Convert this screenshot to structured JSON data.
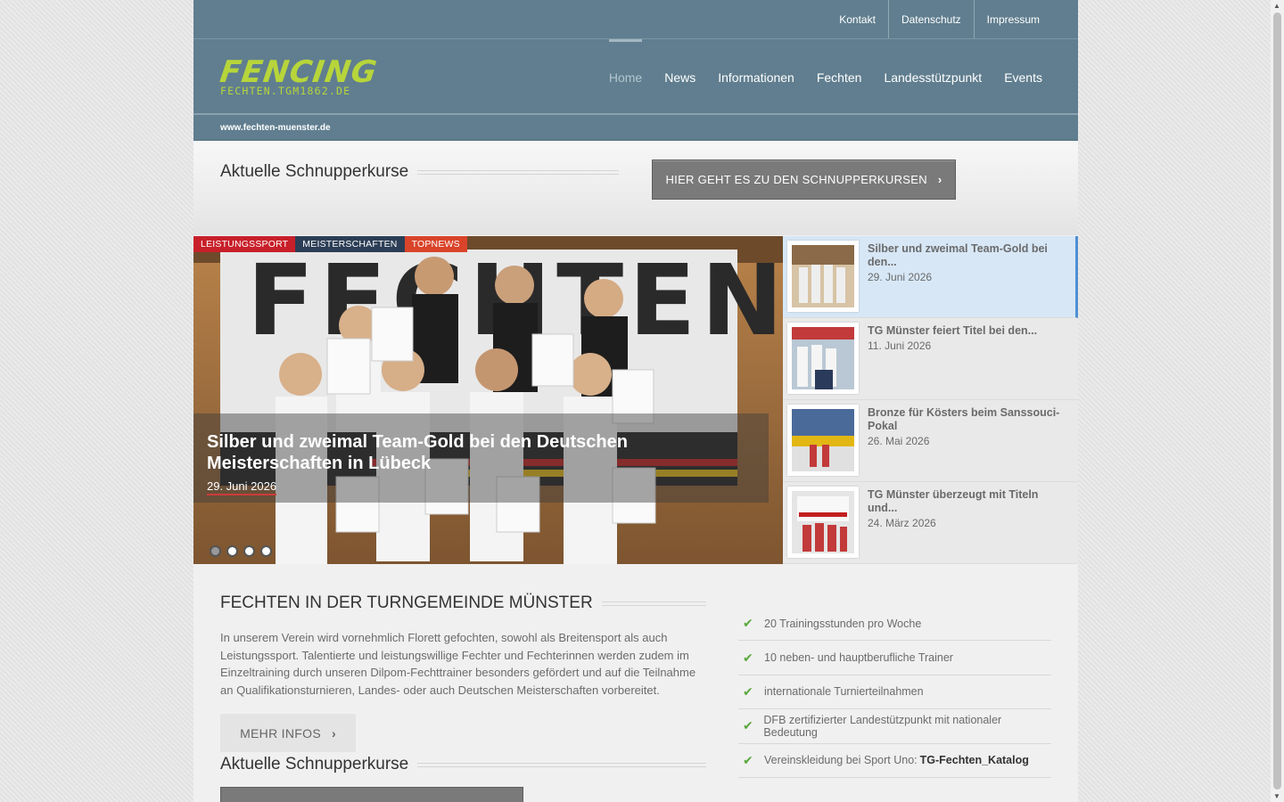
{
  "topbar": {
    "links": [
      "Kontakt",
      "Datenschutz",
      "Impressum"
    ]
  },
  "logo": {
    "main": "FENCING",
    "sub": "FECHTEN.TGM1862.DE"
  },
  "nav": {
    "items": [
      "Home",
      "News",
      "Informationen",
      "Fechten",
      "Landesstützpunkt",
      "Events"
    ]
  },
  "subbar": {
    "text": "www.fechten-muenster.de"
  },
  "schnupper": {
    "title": "Aktuelle Schnupperkurse",
    "button": "HIER GEHT ES ZU DEN SCHNUPPERKURSEN"
  },
  "slider": {
    "categories": [
      {
        "label": "LEISTUNGSSPORT",
        "color": "#c8202a"
      },
      {
        "label": "MEISTERSCHAFTEN",
        "color": "#2c3e56"
      },
      {
        "label": "TOPNEWS",
        "color": "#d9442a"
      }
    ],
    "title": "Silber und zweimal Team-Gold bei den Deutschen Meisterschaften in Lübeck",
    "date": "29. Juni 2026",
    "banner_text": "FECHTEN",
    "dots": 4,
    "active_dot": 0
  },
  "sidelist": [
    {
      "title": "Silber und zweimal Team-Gold bei den...",
      "date": "29. Juni 2026",
      "active": true
    },
    {
      "title": "TG Münster feiert Titel bei den...",
      "date": "11. Juni 2026",
      "active": false
    },
    {
      "title": "Bronze für Kösters beim Sanssouci-Pokal",
      "date": "26. Mai 2026",
      "active": false
    },
    {
      "title": "TG Münster überzeugt mit Titeln und...",
      "date": "24. März 2026",
      "active": false
    }
  ],
  "about": {
    "title": "FECHTEN IN DER TURNGEMEINDE MÜNSTER",
    "text": "In unserem Verein wird vornehmlich Florett gefochten, sowohl als Breitensport als auch Leistungssport. Talentierte und leistungswillige Fechter und Fechterinnen werden zudem im Einzeltraining durch unseren Dilpom-Fechttrainer besonders gefördert und auf die Teilnahme an Qualifikationsturnieren, Landes- oder auch Deutschen Meisterschaften vorbereitet.",
    "button": "MEHR INFOS",
    "title2": "Aktuelle Schnupperkurse"
  },
  "checklist": [
    {
      "text": "20 Trainingsstunden pro Woche",
      "bold": ""
    },
    {
      "text": "10 neben- und hauptberufliche Trainer",
      "bold": ""
    },
    {
      "text": "internationale Turnierteilnahmen",
      "bold": ""
    },
    {
      "text": "DFB zertifizierter Landestützpunkt mit nationaler Bedeutung",
      "bold": ""
    },
    {
      "text": "Vereinskleidung bei Sport Uno:",
      "bold": "TG-Fechten_Katalog"
    }
  ]
}
